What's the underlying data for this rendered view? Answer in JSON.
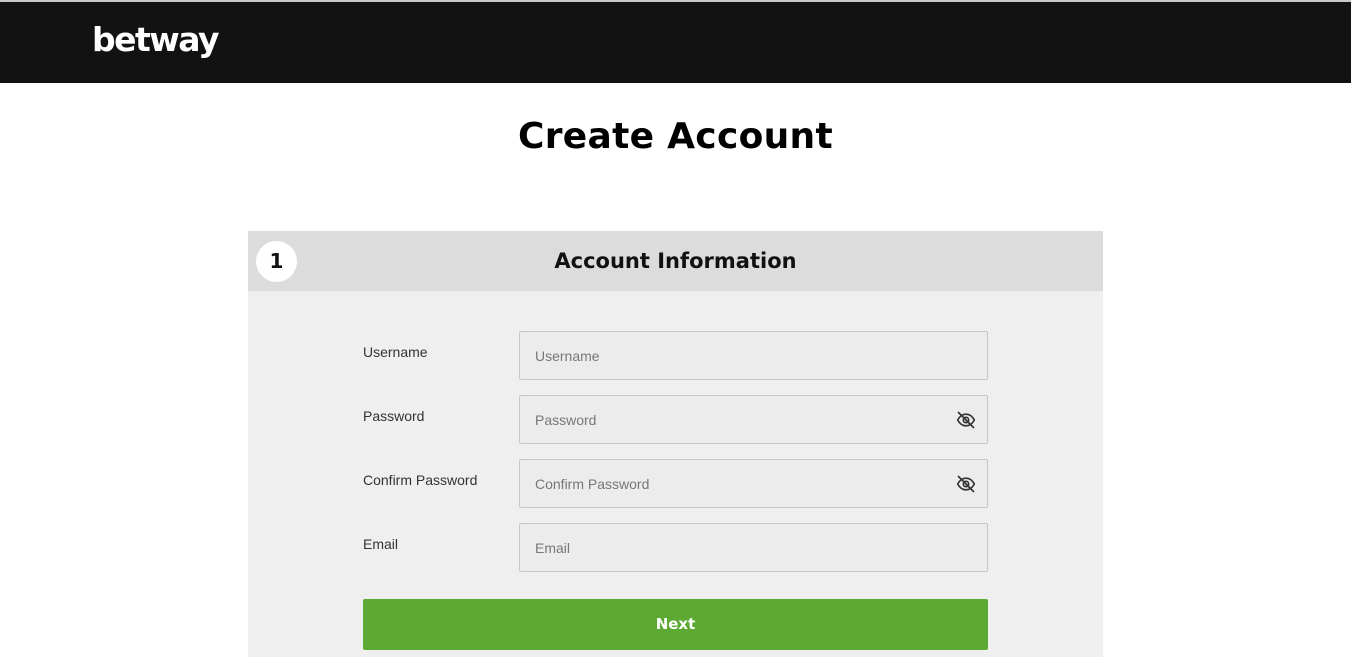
{
  "header": {
    "logo_text": "betway",
    "background_color": "#121212"
  },
  "page": {
    "title": "Create Account"
  },
  "form": {
    "step_number": "1",
    "section_title": "Account Information",
    "fields": [
      {
        "label": "Username",
        "placeholder": "Username",
        "value": ""
      },
      {
        "label": "Password",
        "placeholder": "Password",
        "value": "",
        "toggle_icon": "eye-off-icon"
      },
      {
        "label": "Confirm Password",
        "placeholder": "Confirm Password",
        "value": "",
        "toggle_icon": "eye-off-icon"
      },
      {
        "label": "Email",
        "placeholder": "Email",
        "value": ""
      }
    ],
    "next_label": "Next",
    "accent_color": "#5ca933"
  }
}
